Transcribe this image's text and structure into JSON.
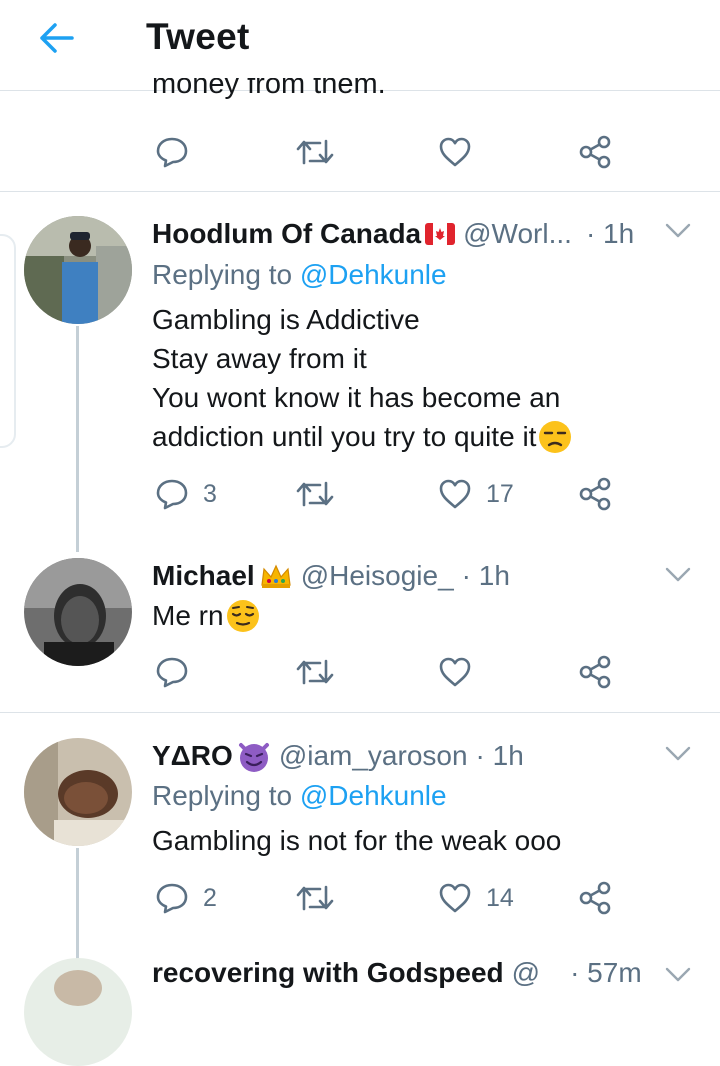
{
  "header": {
    "title": "Tweet"
  },
  "previous_tweet": {
    "cut_text": "money from them."
  },
  "tweets": [
    {
      "name": "Hoodlum Of Canada",
      "handle": "@Worl...",
      "time": "· 1h",
      "replying_label": "Replying to",
      "replying_to": "@Dehkunle",
      "lines": [
        "Gambling is Addictive",
        "Stay away from it",
        "You wont know it has become an",
        "addiction until you try to quite it"
      ],
      "replies": "3",
      "retweets": "",
      "likes": "17"
    },
    {
      "name": "Michael",
      "handle": "@Heisogie_",
      "time": "· 1h",
      "lines": [
        "Me rn"
      ],
      "replies": "",
      "retweets": "",
      "likes": ""
    },
    {
      "name": "YΔRO",
      "handle": "@iam_yaroson",
      "time": "· 1h",
      "replying_label": "Replying to",
      "replying_to": "@Dehkunle",
      "lines": [
        "Gambling is not for the weak ooo"
      ],
      "replies": "2",
      "retweets": "",
      "likes": "14"
    },
    {
      "name": "recovering with Godspeed",
      "handle": "@",
      "time": "· 57m"
    }
  ],
  "colors": {
    "accent": "#1da1f2",
    "secondary": "#5b7083",
    "divider": "#dde3e8"
  }
}
